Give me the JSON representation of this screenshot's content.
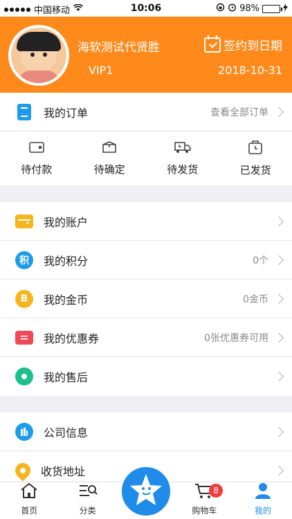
{
  "status_bar": {
    "carrier": "中国移动",
    "time": "10:06",
    "battery_percent": "98%",
    "battery_level": 0.98
  },
  "profile": {
    "name": "海软测试代贤胜",
    "level": "VIP1",
    "sign_label": "签约到日期",
    "sign_date": "2018-10-31"
  },
  "orders": {
    "title": "我的订单",
    "view_all": "查看全部订单",
    "states": [
      {
        "label": "待付款",
        "icon": "wallet-outline-icon"
      },
      {
        "label": "待确定",
        "icon": "box-outline-icon"
      },
      {
        "label": "待发货",
        "icon": "truck-clock-icon"
      },
      {
        "label": "已发货",
        "icon": "package-clock-icon"
      }
    ]
  },
  "assets": [
    {
      "label": "我的账户",
      "value": "",
      "icon": "wallet-icon",
      "color": "#f5b51c"
    },
    {
      "label": "我的积分",
      "value": "0个",
      "icon": "points-icon",
      "glyph": "积",
      "color": "#1e9be9"
    },
    {
      "label": "我的金币",
      "value": "0金币",
      "icon": "coin-icon",
      "glyph": "B",
      "color": "#f5b51c"
    },
    {
      "label": "我的优惠券",
      "value": "0张优惠券可用",
      "icon": "coupon-icon",
      "color": "#ef4a56"
    },
    {
      "label": "我的售后",
      "value": "",
      "icon": "after-sales-icon",
      "color": "#1dbf8c"
    }
  ],
  "more": [
    {
      "label": "公司信息",
      "icon": "company-icon",
      "color": "#1e9be9"
    },
    {
      "label": "收货地址",
      "icon": "location-pin-icon",
      "color": "#f5b51c"
    }
  ],
  "tabbar": {
    "home": "首页",
    "category": "分类",
    "cart": "购物车",
    "cart_badge": "8",
    "me": "我的",
    "accent": "#1e8ce8"
  }
}
